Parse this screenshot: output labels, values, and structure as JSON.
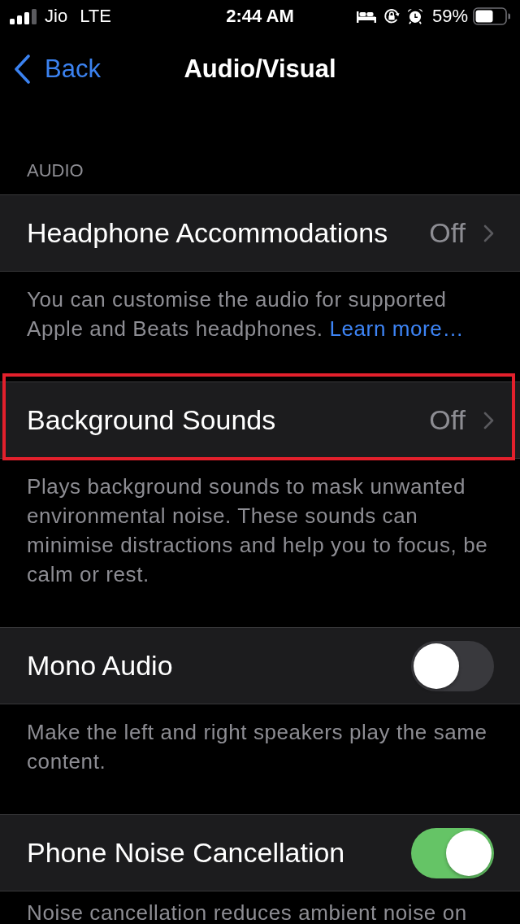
{
  "status_bar": {
    "carrier": "Jio",
    "network": "LTE",
    "time": "2:44 AM",
    "battery": "59%"
  },
  "nav_bar": {
    "back": "Back",
    "title": "Audio/Visual"
  },
  "section": {
    "header": "AUDIO"
  },
  "groups": [
    {
      "row": {
        "kind": "disclosure",
        "label": "Headphone Accommodations",
        "value": "Off",
        "highlighted": false
      },
      "footer": {
        "text": "You can customise the audio for supported Apple and Beats headphones.",
        "link": "Learn more…"
      }
    },
    {
      "row": {
        "kind": "disclosure",
        "label": "Background Sounds",
        "value": "Off",
        "highlighted": true
      },
      "footer": {
        "text": "Plays background sounds to mask unwanted environmental noise. These sounds can minimise distractions and help you to focus, be calm or rest."
      }
    },
    {
      "row": {
        "kind": "toggle",
        "label": "Mono Audio",
        "on": false,
        "highlighted": false
      },
      "footer": {
        "text": "Make the left and right speakers play the same content."
      }
    },
    {
      "row": {
        "kind": "toggle",
        "label": "Phone Noise Cancellation",
        "on": true,
        "highlighted": false
      },
      "footer": {
        "text": "Noise cancellation reduces ambient noise on"
      }
    }
  ]
}
